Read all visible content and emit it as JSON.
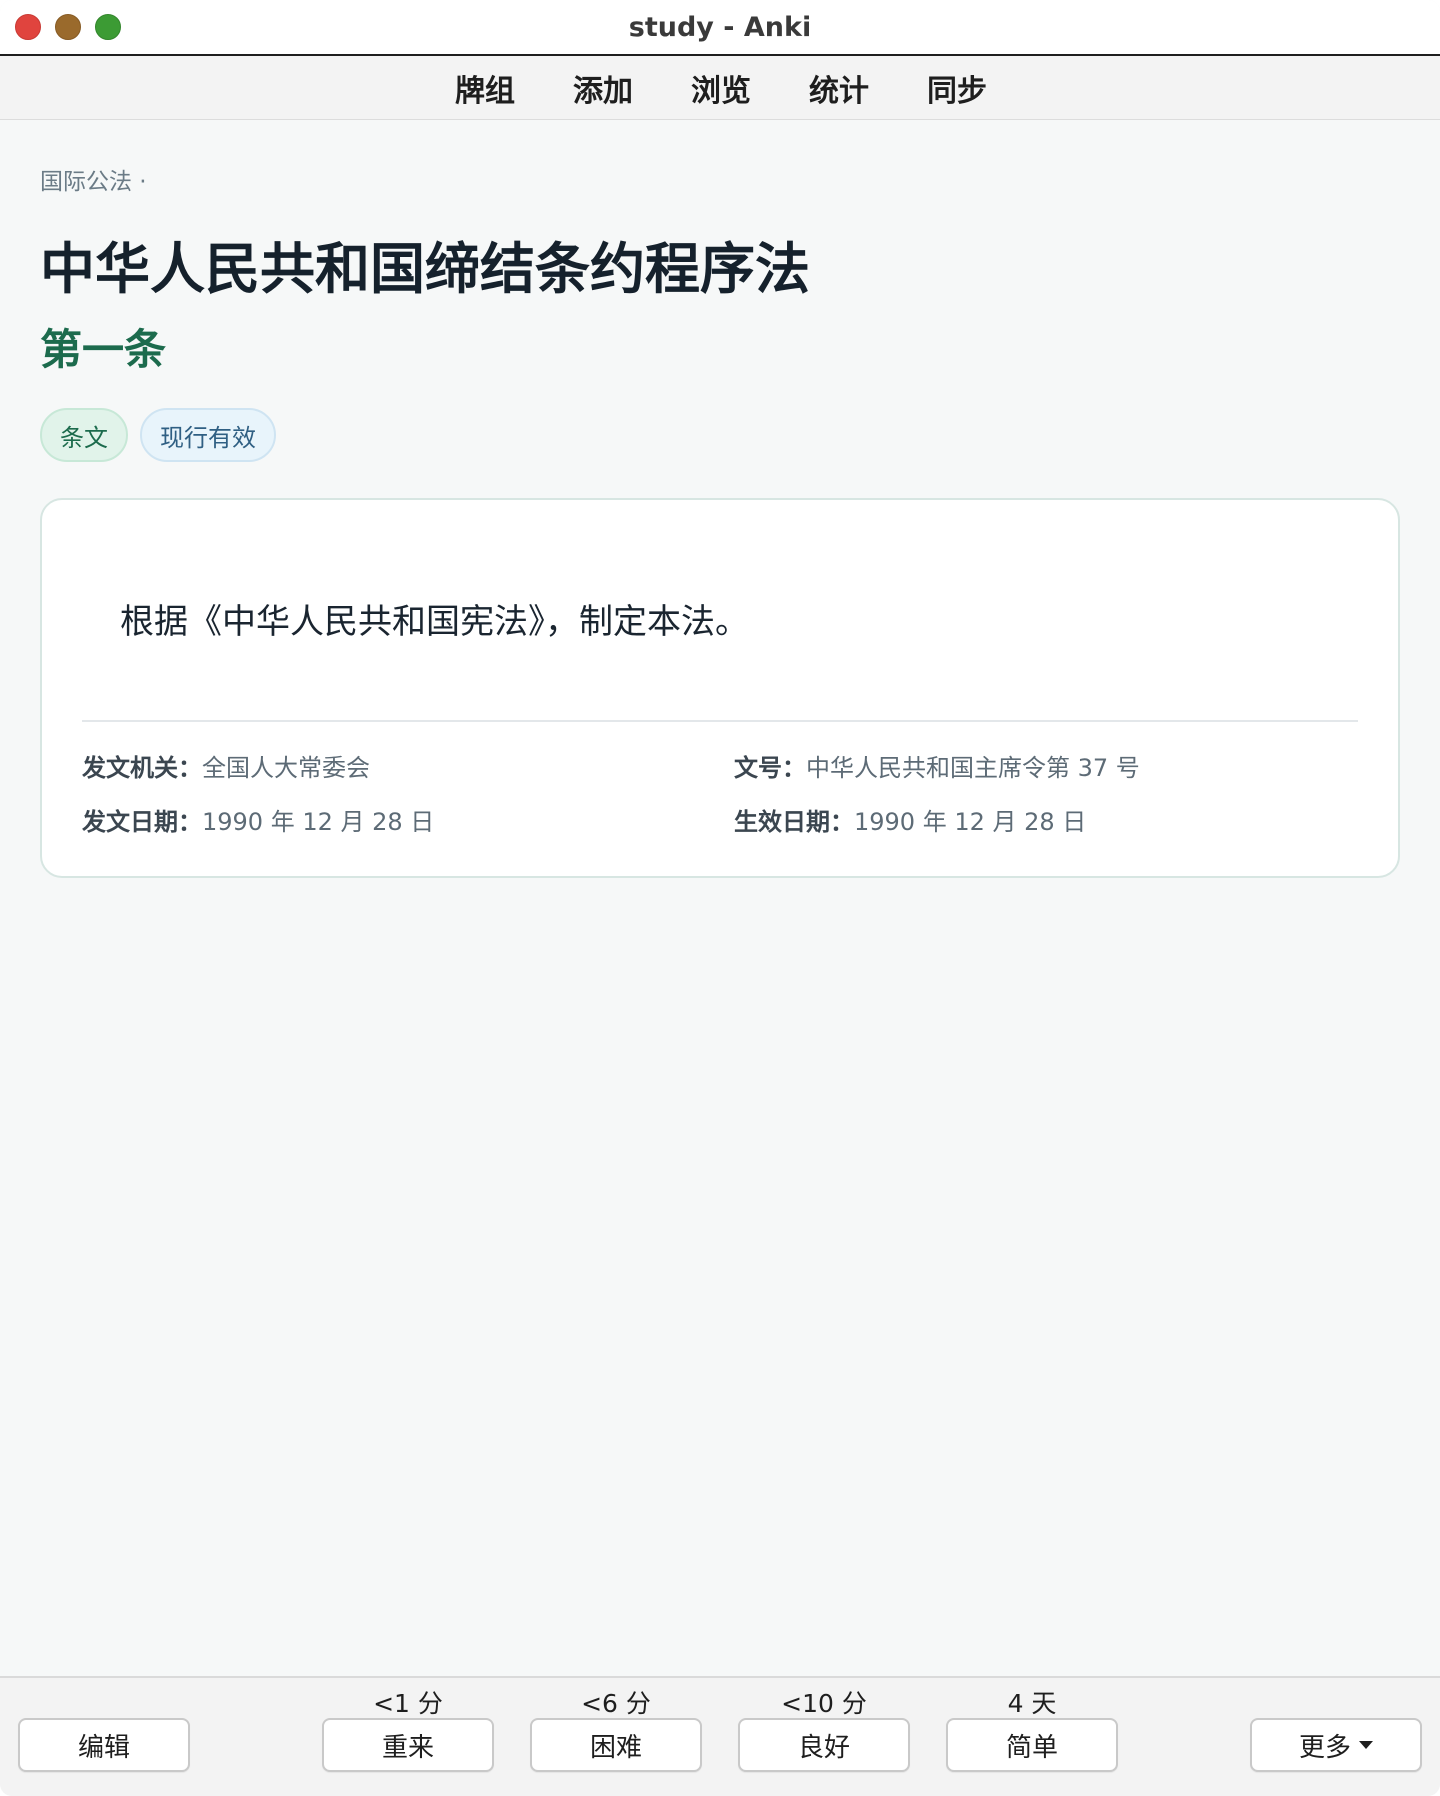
{
  "window": {
    "title": "study - Anki"
  },
  "toolbar": {
    "items": [
      {
        "label": "牌组"
      },
      {
        "label": "添加"
      },
      {
        "label": "浏览"
      },
      {
        "label": "统计"
      },
      {
        "label": "同步"
      }
    ]
  },
  "card": {
    "breadcrumb": "国际公法 ·",
    "law_title": "中华人民共和国缔结条约程序法",
    "article_title": "第一条",
    "tags": [
      "条文",
      "现行有效"
    ],
    "text": "根据《中华人民共和国宪法》，制定本法。",
    "meta": {
      "issuer_label": "发文机关：",
      "issuer_value": "全国人大常委会",
      "doc_no_label": "文号：",
      "doc_no_value": "中华人民共和国主席令第 37 号",
      "issue_date_label": "发文日期：",
      "issue_date_value": "1990 年 12 月 28 日",
      "effective_date_label": "生效日期：",
      "effective_date_value": "1990 年 12 月 28 日"
    }
  },
  "bottom": {
    "edit_label": "编辑",
    "answers": [
      {
        "interval": "<1 分",
        "label": "重来"
      },
      {
        "interval": "<6 分",
        "label": "困难"
      },
      {
        "interval": "<10 分",
        "label": "良好"
      },
      {
        "interval": "4 天",
        "label": "简单"
      }
    ],
    "more_label": "更多"
  },
  "colors": {
    "accent_green": "#1c6b4d",
    "tag_blue": "#2f5f83",
    "close": "#e0443e",
    "minimize": "#9a6a2c",
    "zoom": "#3c9b34"
  }
}
